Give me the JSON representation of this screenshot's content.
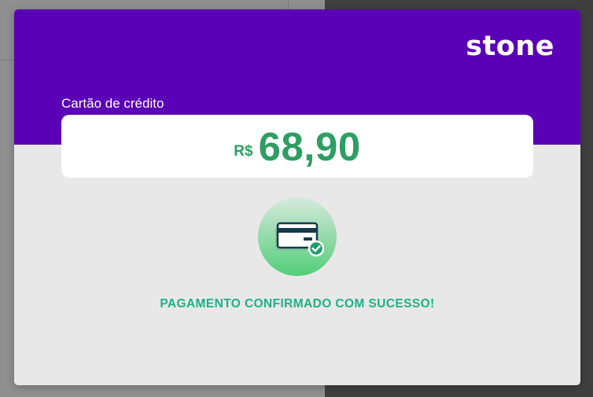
{
  "modal": {
    "brand": "stone",
    "payment_method_label": "Cartão de crédito",
    "currency_symbol": "R$",
    "amount": "68,90",
    "status_message": "PAGAMENTO CONFIRMADO COM SUCESSO!",
    "status_icon": "credit-card-check-icon"
  },
  "colors": {
    "header": "#5a00b6",
    "amount": "#2e9e62",
    "status": "#1bb287",
    "modal_background": "#e8e8e8",
    "badge_gradient_end": "#52cf78",
    "card_outline": "#163a4e",
    "check": "#1f9d6a"
  }
}
